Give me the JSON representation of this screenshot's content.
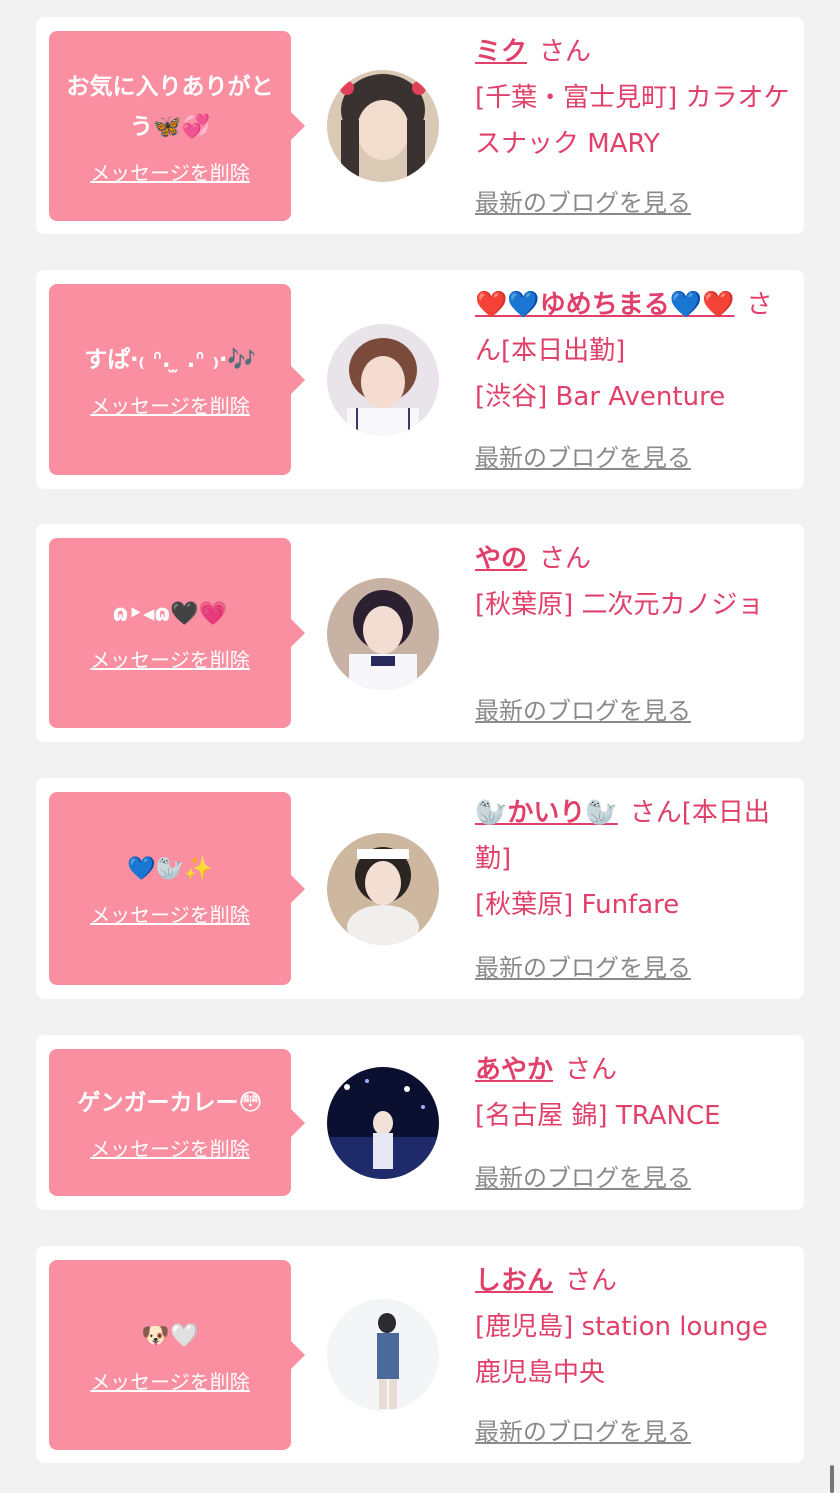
{
  "delete_label": "メッセージを削除",
  "blog_label": "最新のブログを見る",
  "san_suffix": "さん",
  "entries": [
    {
      "message": "お気に入りありがとう🦋💞",
      "name": "ミク",
      "suffix": "さん",
      "shop": "[千葉・富士見町] カラオケスナック MARY",
      "avatar_colors": [
        "#d9c9b5",
        "#3a3230"
      ]
    },
    {
      "message": "すぱ‧₍ ᐢ. ̫ .ᐢ ₎‧🎶",
      "name": "❤️💙ゆめちまる💙❤️",
      "suffix": "さん[本日出勤]",
      "shop": "[渋谷] Bar Aventure",
      "avatar_colors": [
        "#e9e4ea",
        "#7a4a3a"
      ]
    },
    {
      "message": "ɷ‣◂ɷ🖤💗",
      "name": "やの",
      "suffix": "さん",
      "shop": "[秋葉原] 二次元カノジョ",
      "avatar_colors": [
        "#c8b2a4",
        "#2a2030"
      ]
    },
    {
      "message": "💙🦭✨",
      "name": "🦭かいり🦭",
      "suffix": "さん[本日出勤]",
      "shop": "[秋葉原] Funfare",
      "avatar_colors": [
        "#cdb79f",
        "#2b2522"
      ]
    },
    {
      "message": "ゲンガーカレー😳",
      "name": "あやか",
      "suffix": "さん",
      "shop": "[名古屋 錦] TRANCE",
      "avatar_colors": [
        "#1e2a6a",
        "#0b1030"
      ]
    },
    {
      "message": "🐶🤍",
      "name": "しおん",
      "suffix": "さん",
      "shop": "[鹿児島] station lounge 鹿児島中央",
      "avatar_colors": [
        "#f4f5f7",
        "#4a6a9a"
      ]
    }
  ]
}
